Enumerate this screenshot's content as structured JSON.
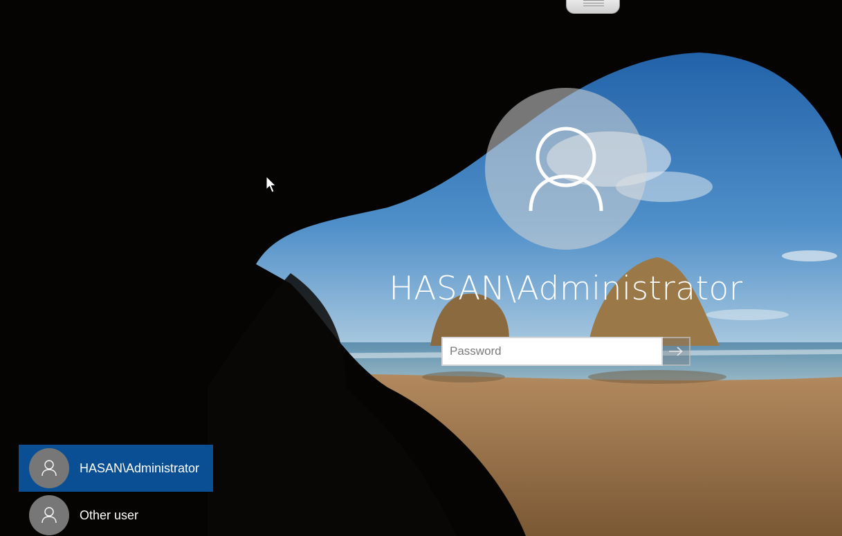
{
  "screen": {
    "name": "windows-lock-screen"
  },
  "user": {
    "display_name": "HASAN\\Administrator",
    "avatar_icon": "user-silhouette-icon"
  },
  "password": {
    "value": "",
    "placeholder": "Password",
    "submit_icon": "arrow-right-icon"
  },
  "user_list": [
    {
      "label": "HASAN\\Administrator",
      "selected": true,
      "icon": "user-silhouette-icon"
    },
    {
      "label": "Other user",
      "selected": false,
      "icon": "user-silhouette-icon"
    }
  ],
  "colors": {
    "selected_tile": "#0a4f93",
    "tile_avatar": "#777777",
    "text": "#ffffff"
  }
}
